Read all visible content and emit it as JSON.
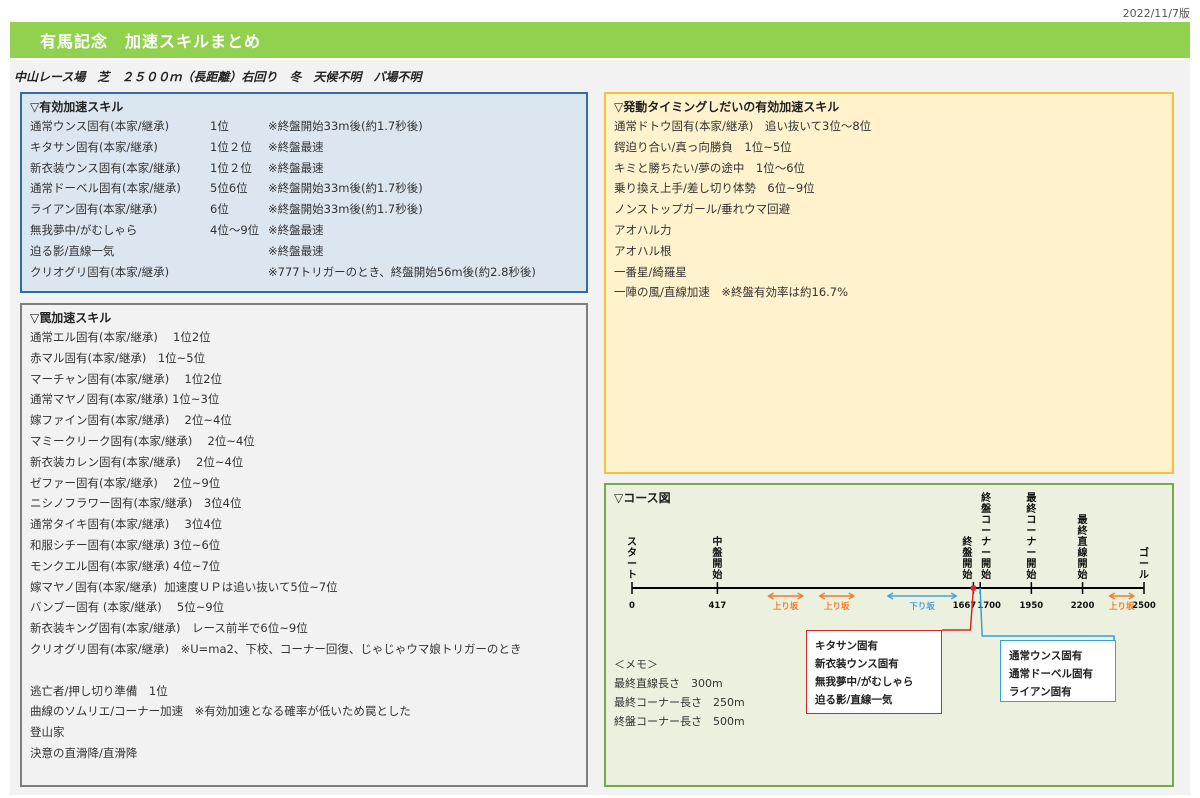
{
  "version": "2022/11/7版",
  "banner": "有馬記念　加速スキルまとめ",
  "subtitle": "中山レース場　芝　２５００ｍ（長距離）右回り　冬　天候不明　バ場不明",
  "valid_box": {
    "title": "▽有効加速スキル",
    "rows": [
      {
        "skill": "通常ウンス固有(本家/継承)",
        "rank": "1位",
        "note": "※終盤開始33m後(約1.7秒後)"
      },
      {
        "skill": "キタサン固有(本家/継承)",
        "rank": "1位２位",
        "note": "※終盤最速"
      },
      {
        "skill": "新衣装ウンス固有(本家/継承)",
        "rank": "1位２位",
        "note": "※終盤最速"
      },
      {
        "skill": "通常ドーベル固有(本家/継承)",
        "rank": "5位6位",
        "note": "※終盤開始33m後(約1.7秒後)"
      },
      {
        "skill": "ライアン固有(本家/継承)",
        "rank": "6位",
        "note": "※終盤開始33m後(約1.7秒後)"
      },
      {
        "skill": "無我夢中/がむしゃら",
        "rank": "4位〜9位",
        "note": "※終盤最速"
      },
      {
        "skill": "迫る影/直線一気",
        "rank": "",
        "note": "※終盤最速"
      },
      {
        "skill": "クリオグリ固有(本家/継承)",
        "rank": "",
        "note": "※777トリガーのとき、終盤開始56m後(約2.8秒後)"
      }
    ]
  },
  "trap_box": {
    "title": "▽罠加速スキル",
    "lines": [
      "通常エル固有(本家/継承)　 1位2位",
      "赤マル固有(本家/継承)　1位~5位",
      "マーチャン固有(本家/継承)　 1位2位",
      "通常マヤノ固有(本家/継承) 1位~3位",
      "嫁ファイン固有(本家/継承)　 2位~4位",
      "マミークリーク固有(本家/継承)　 2位~4位",
      "新衣装カレン固有(本家/継承)　 2位~4位",
      "ゼファー固有(本家/継承)　 2位~9位",
      "ニシノフラワー固有(本家/継承)　3位4位",
      "通常タイキ固有(本家/継承)　 3位4位",
      "和服シチー固有(本家/継承) 3位~6位",
      "モンクエル固有(本家/継承) 4位~7位",
      "嫁マヤノ固有(本家/継承)  加速度ＵＰは追い抜いて5位~7位",
      "バンブー固有 (本家/継承)　 5位~9位",
      "新衣装キング固有(本家/継承)　レース前半で6位~9位",
      "クリオグリ固有(本家/継承)　※U=ma2、下校、コーナー回復、じゃじゃウマ娘トリガーのとき",
      "",
      "逃亡者/押し切り準備　1位",
      "曲線のソムリエ/コーナー加速　※有効加速となる確率が低いため罠とした",
      "登山家",
      "決意の直滑降/直滑降"
    ]
  },
  "timing_box": {
    "title": "▽発動タイミングしだいの有効加速スキル",
    "lines": [
      "通常ドトウ固有(本家/継承)　追い抜いて3位〜8位",
      "鍔迫り合い/真っ向勝負　1位~5位",
      "キミと勝ちたい/夢の途中　1位〜6位",
      "乗り換え上手/差し切り体勢　6位~9位",
      "ノンストップガール/垂れウマ回避",
      "アオハル力",
      "アオハル根",
      "一番星/綺羅星",
      "一陣の風/直線加速　※終盤有効率は約16.7%"
    ]
  },
  "course_box": {
    "title": "▽コース図",
    "markers": [
      {
        "label": "スタート",
        "distance": 0
      },
      {
        "label": "中盤開始",
        "distance": 417
      },
      {
        "label": "終盤開始",
        "distance": 1667
      },
      {
        "label": "終盤コーナー開始",
        "distance": 1700
      },
      {
        "label": "最終コーナー開始",
        "distance": 1950
      },
      {
        "label": "最終直線開始",
        "distance": 2200
      },
      {
        "label": "ゴール",
        "distance": 2500
      }
    ],
    "tick_labels": {
      "start": "0",
      "mid": "417",
      "final": "1667",
      "corner": "1700",
      "last_corner": "1950",
      "straight": "2200",
      "goal": "2500"
    },
    "slopes": [
      {
        "label": "上り坂",
        "from": 667,
        "to": 833,
        "color": "#ed7d31"
      },
      {
        "label": "上り坂",
        "from": 917,
        "to": 1083,
        "color": "#ed7d31"
      },
      {
        "label": "下り坂",
        "from": 1250,
        "to": 1583,
        "color": "#4a9fd8"
      },
      {
        "label": "上り坂",
        "from": 2333,
        "to": 2450,
        "color": "#ed7d31"
      }
    ],
    "memo": {
      "title": "＜メモ＞",
      "lines": [
        "最終直線長さ　300m",
        "最終コーナー長さ　250m",
        "終盤コーナー長さ　500m"
      ]
    },
    "red_callout": [
      "キタサン固有",
      "新衣装ウンス固有",
      "無我夢中/がむしゃら",
      "迫る影/直線一気"
    ],
    "blue_callout": [
      "通常ウンス固有",
      "通常ドーベル固有",
      "ライアン固有"
    ],
    "colors": {
      "red": "#d62728",
      "blue": "#35a3d8",
      "slope_up": "#ed7d31",
      "slope_down": "#4a9fd8"
    }
  }
}
